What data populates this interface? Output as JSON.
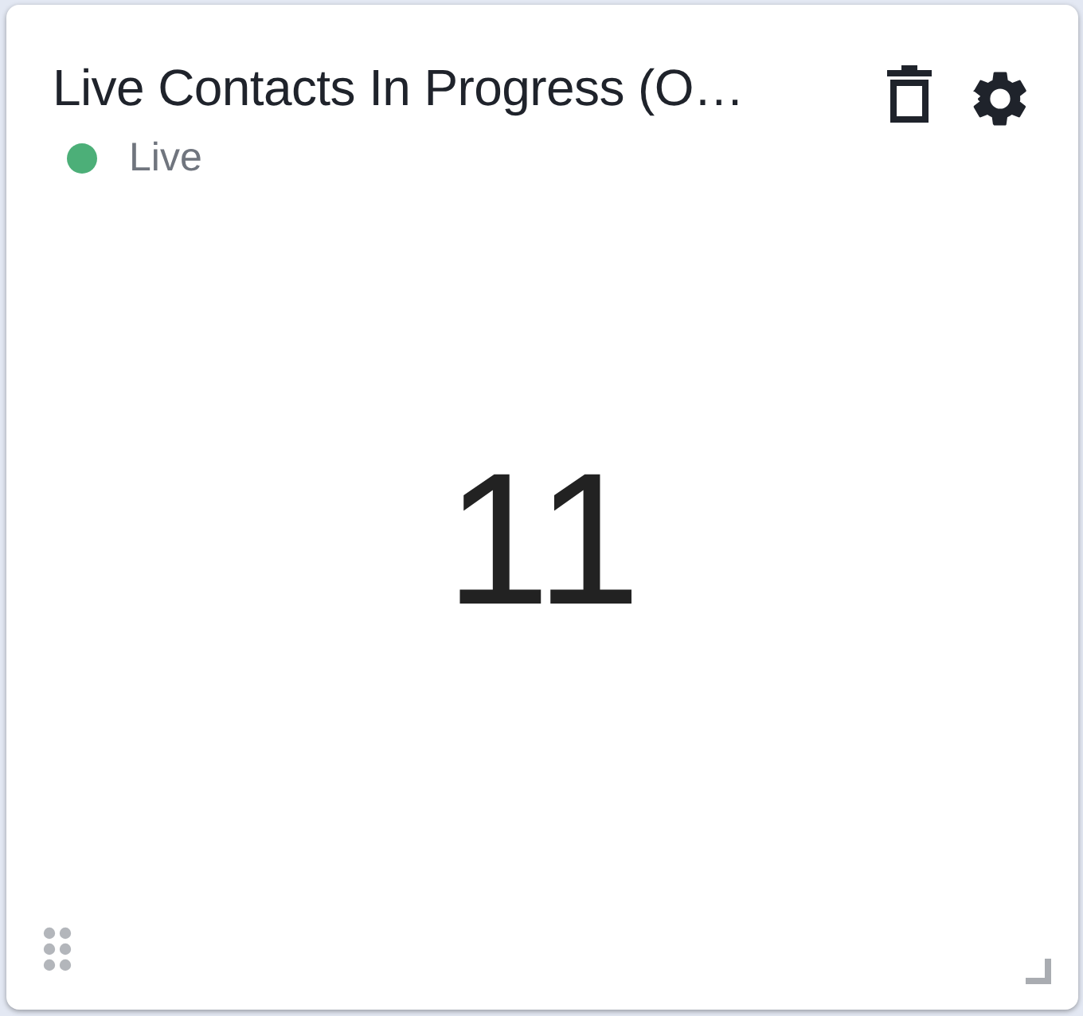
{
  "widget": {
    "title": "Live Contacts In Progress (O…",
    "status": {
      "label": "Live",
      "color": "#4caf78"
    },
    "value": "11"
  }
}
